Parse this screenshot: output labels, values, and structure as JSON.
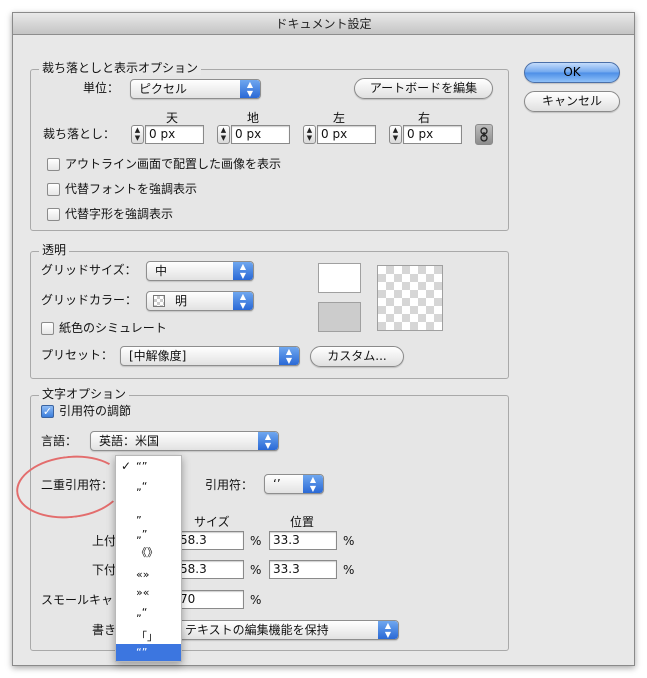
{
  "window": {
    "title": "ドキュメント設定"
  },
  "buttons": {
    "ok": "OK",
    "cancel": "キャンセル",
    "edit_artboards": "アートボードを編集",
    "custom": "カスタム..."
  },
  "bleed": {
    "legend": "裁ち落としと表示オプション",
    "unit_label": "単位：",
    "unit_value": "ピクセル",
    "bleed_label": "裁ち落とし：",
    "headers": [
      "天",
      "地",
      "左",
      "右"
    ],
    "values": [
      "0 px",
      "0 px",
      "0 px",
      "0 px"
    ],
    "options": [
      {
        "label": "アウトライン画面で配置した画像を表示",
        "checked": false
      },
      {
        "label": "代替フォントを強調表示",
        "checked": false
      },
      {
        "label": "代替字形を強調表示",
        "checked": false
      }
    ]
  },
  "transparency": {
    "legend": "透明",
    "grid_size_label": "グリッドサイズ：",
    "grid_size_value": "中",
    "grid_color_label": "グリッドカラー：",
    "grid_color_value": "明",
    "simulate_paper_label": "紙色のシミュレート",
    "simulate_paper_checked": false,
    "preset_label": "プリセット：",
    "preset_value": "[中解像度]",
    "swatch_top_color": "#ffffff",
    "swatch_bottom_color": "#cccccc"
  },
  "type": {
    "legend": "文字オプション",
    "smart_quotes_label": "引用符の調節",
    "smart_quotes_checked": true,
    "language_label": "言語：",
    "language_value": "英語：米国",
    "double_quotes_label": "二重引用符：",
    "single_quotes_label": "引用符：",
    "single_quotes_value": "‘’",
    "col_size": "サイズ",
    "col_position": "位置",
    "superscript_label": "上付き",
    "superscript_size": "58.3",
    "superscript_position": "33.3",
    "subscript_label": "下付き",
    "subscript_size": "58.3",
    "subscript_position": "33.3",
    "smallcaps_label": "スモールキャップ",
    "smallcaps_size": "70",
    "percent": "%",
    "export_label": "書き出し：",
    "export_value": "テキストの編集機能を保持"
  },
  "quote_menu": {
    "items": [
      "“”",
      "„“",
      "”",
      "„”",
      "《》",
      "«»",
      "»«",
      "„“",
      "「」",
      "“”"
    ],
    "checked_index": 0,
    "highlight_index": 9
  },
  "colors": {
    "accent": "#3c76e0",
    "highlight_ring": "#e36d6d"
  }
}
